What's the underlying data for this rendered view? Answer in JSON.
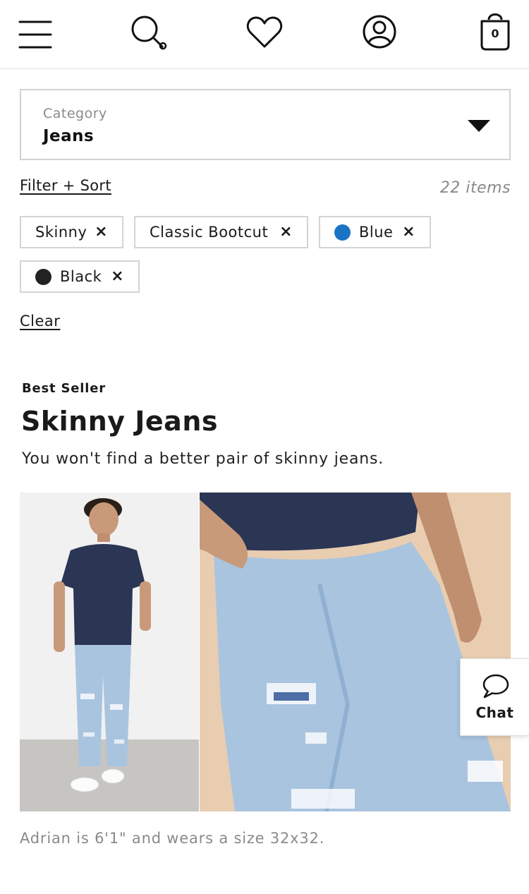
{
  "header": {
    "menu_icon": "hamburger-icon",
    "search_icon": "search-icon",
    "wishlist_icon": "heart-icon",
    "account_icon": "user-circle-icon",
    "bag_icon": "shopping-bag-icon",
    "bag_count": "0"
  },
  "category": {
    "label": "Category",
    "value": "Jeans",
    "dropdown_icon": "caret-down-icon"
  },
  "filters": {
    "filter_sort_label": "Filter + Sort",
    "item_count": "22 items",
    "chips": [
      {
        "label": "Skinny",
        "remove": "×"
      },
      {
        "label": "Classic Bootcut",
        "remove": "×"
      },
      {
        "label": "Blue",
        "swatch": "#1a73c4",
        "remove": "×"
      },
      {
        "label": "Black",
        "swatch": "#222222",
        "remove": "×"
      }
    ],
    "clear_label": "Clear"
  },
  "promo": {
    "eyebrow": "Best Seller",
    "title": "Skinny Jeans",
    "subtitle": "You won't find a better pair of skinny jeans.",
    "caption": "Adrian is 6'1\" and wears a size 32x32."
  },
  "chat": {
    "icon": "chat-bubble-icon",
    "label": "Chat"
  },
  "colors": {
    "denim_light": "#a9c4df",
    "tee_navy": "#2b3554",
    "backdrop_left": "#f1f1f1",
    "backdrop_right": "#e8cdb1"
  }
}
